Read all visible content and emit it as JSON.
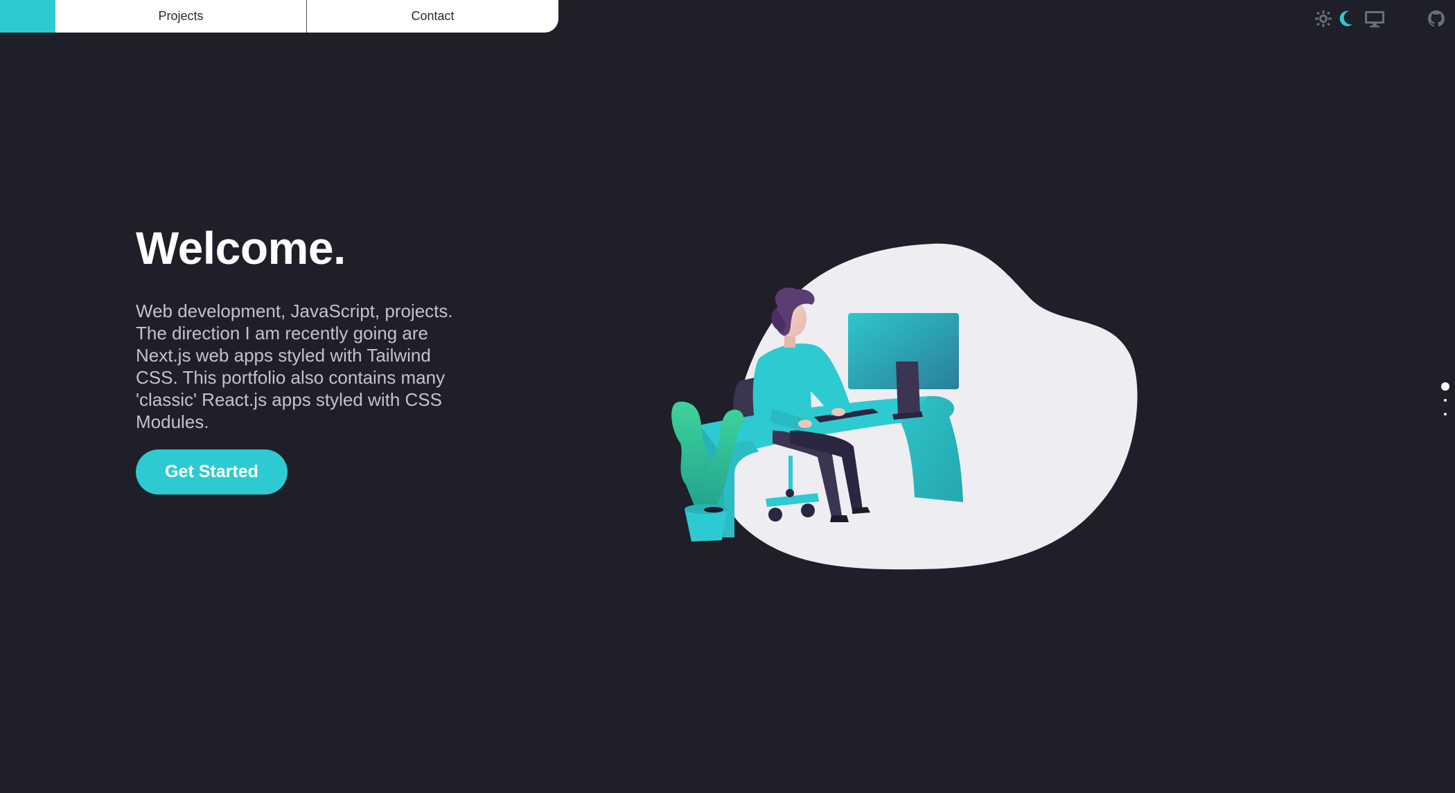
{
  "nav": {
    "links": [
      {
        "label": "Projects"
      },
      {
        "label": "Contact"
      }
    ],
    "accent_color": "#2ecad1"
  },
  "toolbar": {
    "icons": [
      "sun-icon",
      "moon-icon",
      "monitor-icon",
      "github-icon"
    ],
    "active_theme": "dark"
  },
  "hero": {
    "title": "Welcome.",
    "description": "Web development, JavaScript, projects. The direction I am recently going are Next.js web apps styled with Tailwind CSS. This portfolio also contains many 'classic' React.js apps styled with CSS Modules.",
    "cta_label": "Get Started"
  },
  "section_dots": {
    "count": 3,
    "active_index": 0
  },
  "colors": {
    "background": "#1f1f29",
    "accent": "#2ecad1",
    "text_muted": "#c2c3cb"
  }
}
